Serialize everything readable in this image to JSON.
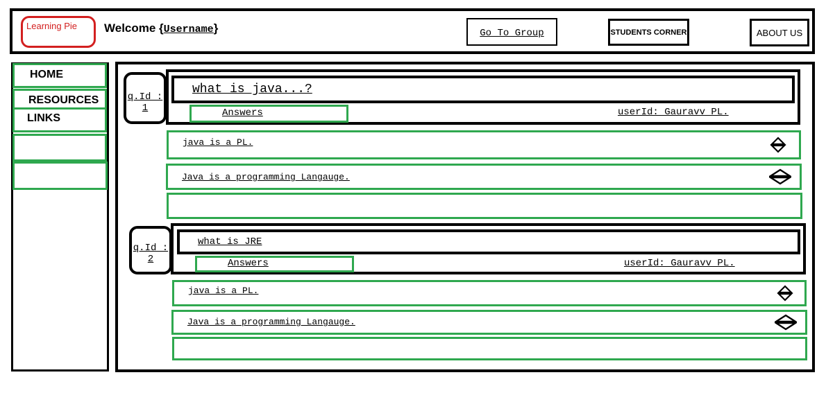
{
  "header": {
    "logo_text": "Learning Pie",
    "welcome_prefix": "Welcome {",
    "username": "Username",
    "welcome_suffix": "}",
    "go_to_group": "Go To Group",
    "students_corner": "STUDENTS CORNER",
    "about_us": "ABOUT US"
  },
  "sidebar": {
    "items": [
      {
        "label": "HOME"
      },
      {
        "label": "RESOURCES"
      },
      {
        "label": "LINKS"
      },
      {
        "label": ""
      },
      {
        "label": ""
      }
    ]
  },
  "questions": [
    {
      "qid": "q.Id : 1",
      "title": "what is java...?",
      "answers_button": "Answers",
      "user_id": "userId: Gauravv PL.",
      "answers": [
        {
          "text": "java is a PL.",
          "vote_icon": "up-down-arrow-icon"
        },
        {
          "text": "Java is a programming Langauge.",
          "vote_icon": "up-down-arrow-icon"
        },
        {
          "text": ""
        }
      ]
    },
    {
      "qid": "q.Id : 2",
      "title": "what is JRE",
      "answers_button": "Answers",
      "user_id": "userId: Gauravv PL.",
      "answers": [
        {
          "text": "java is a PL.",
          "vote_icon": "up-down-arrow-icon"
        },
        {
          "text": "Java is a programming Langauge.",
          "vote_icon": "up-down-arrow-icon"
        },
        {
          "text": ""
        }
      ]
    }
  ],
  "colors": {
    "border": "#000000",
    "green": "#2fa84f",
    "logo_red": "#d32020"
  }
}
